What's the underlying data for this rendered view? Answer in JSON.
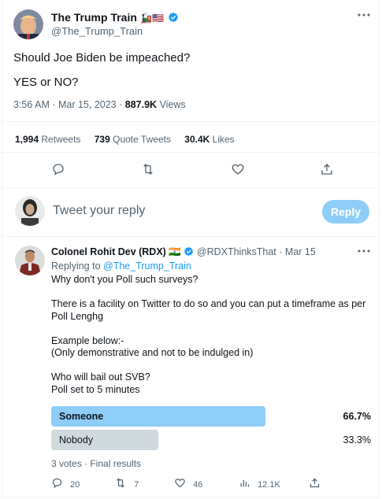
{
  "tweet": {
    "author_name": "The Trump Train",
    "author_handle": "@The_Trump_Train",
    "text_line1": "Should Joe Biden be impeached?",
    "text_line2": "YES or NO?",
    "timestamp": "3:56 AM · Mar 15, 2023",
    "views_count": "887.9K",
    "views_label": "Views",
    "stats": {
      "retweets_count": "1,994",
      "retweets_label": "Retweets",
      "quotes_count": "739",
      "quotes_label": "Quote Tweets",
      "likes_count": "30.4K",
      "likes_label": "Likes"
    },
    "actions": [
      "reply-icon",
      "retweet-icon",
      "like-icon",
      "share-icon"
    ]
  },
  "compose": {
    "placeholder": "Tweet your reply",
    "button_label": "Reply"
  },
  "reply_tweet": {
    "author_name": "Colonel Rohit Dev (RDX)",
    "flag": "🇮🇳",
    "author_handle": "@RDXThinksThat",
    "date": "· Mar 15",
    "replying_to_label": "Replying to",
    "replying_to_handle": "@The_Trump_Train",
    "body": [
      "Why don't you Poll such surveys?",
      "",
      "There is a facility on Twitter to do so and you can put a timeframe as per",
      "Poll Lenghg",
      "",
      "Example below:-",
      "(Only demonstrative and not to be indulged in)",
      "",
      "Who will bail out SVB?",
      "Poll set to 5 minutes"
    ],
    "poll": {
      "options": [
        {
          "label": "Someone",
          "percent_label": "66.7%",
          "fraction": 0.667,
          "winner": true
        },
        {
          "label": "Nobody",
          "percent_label": "33.3%",
          "fraction": 0.333,
          "winner": false
        }
      ],
      "summary": "3 votes · Final results"
    },
    "actions": {
      "replies": "20",
      "retweets": "7",
      "likes": "46",
      "views": "12.1K"
    }
  },
  "colors": {
    "accent": "#1d9bf0",
    "poll_winner": "#8ecdf8",
    "poll_other": "#cfd9de",
    "muted_text": "#536471",
    "retweet_icon": "#00ba7c"
  }
}
